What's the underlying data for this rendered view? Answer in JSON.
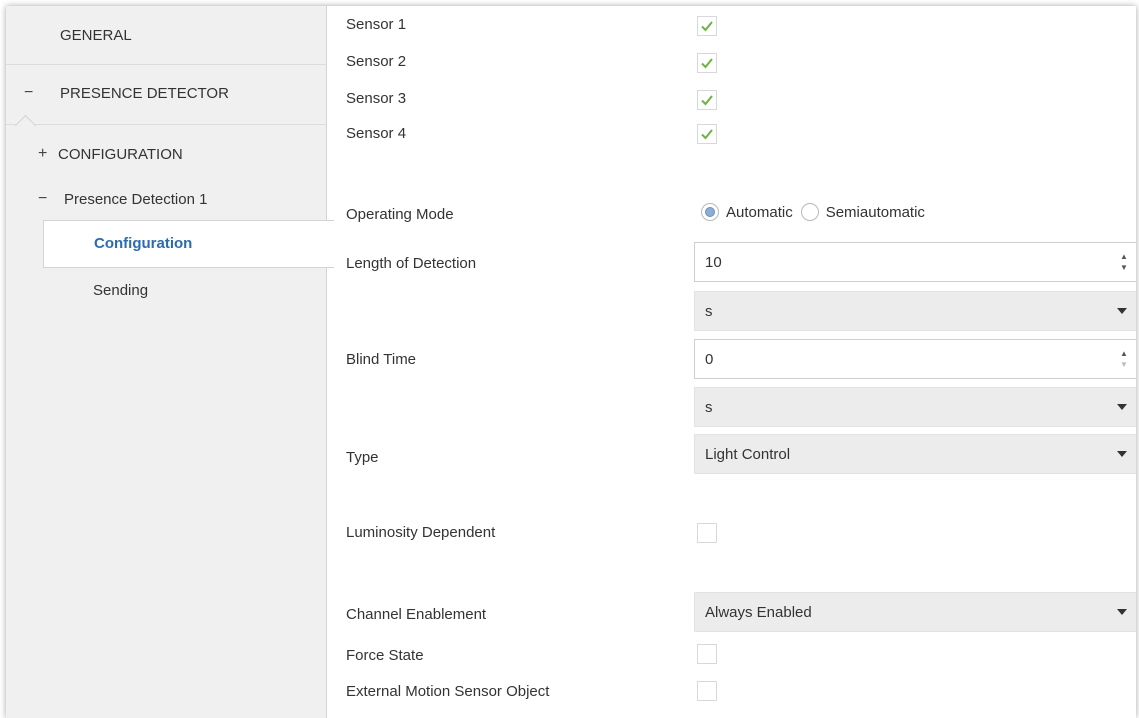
{
  "sidebar": {
    "general": "GENERAL",
    "presence_detector": {
      "sign": "−",
      "label": "PRESENCE DETECTOR"
    },
    "configuration": {
      "sign": "+",
      "label": "CONFIGURATION"
    },
    "presence_detection_1": {
      "sign": "−",
      "label": "Presence Detection 1"
    },
    "active_item": "Configuration",
    "sending": "Sending"
  },
  "main": {
    "sensors": [
      {
        "label": "Sensor 1",
        "checked": true
      },
      {
        "label": "Sensor 2",
        "checked": true
      },
      {
        "label": "Sensor 3",
        "checked": true
      },
      {
        "label": "Sensor 4",
        "checked": true
      }
    ],
    "operating_mode": {
      "label": "Operating Mode",
      "options": [
        "Automatic",
        "Semiautomatic"
      ],
      "selected": "Automatic"
    },
    "length_of_detection": {
      "label": "Length of Detection",
      "value": "10",
      "unit": "s"
    },
    "blind_time": {
      "label": "Blind Time",
      "value": "0",
      "unit": "s"
    },
    "type": {
      "label": "Type",
      "value": "Light Control"
    },
    "luminosity_dependent": {
      "label": "Luminosity Dependent",
      "checked": false
    },
    "channel_enablement": {
      "label": "Channel Enablement",
      "value": "Always Enabled"
    },
    "force_state": {
      "label": "Force State",
      "checked": false
    },
    "external_motion_sensor": {
      "label": "External Motion Sensor Object",
      "checked": false
    }
  },
  "colors": {
    "check": "#6db33f",
    "active_link": "#2b6cb0",
    "sidebar_bg": "#f0f0f0",
    "select_bg": "#ececec"
  }
}
